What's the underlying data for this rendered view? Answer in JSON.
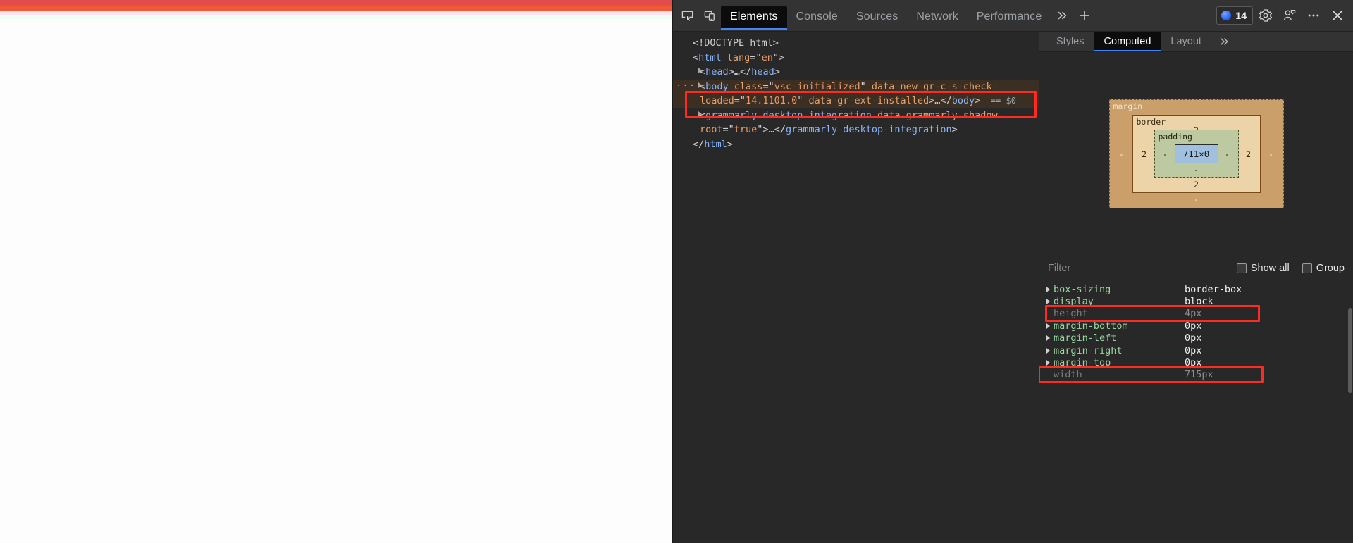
{
  "page": {
    "highlight_overlay": {
      "margin_color": "#e34c4c",
      "border_color": "#f05a32",
      "padding_color": "#fde4f1",
      "content_color": "#f0fdf4"
    }
  },
  "devtools": {
    "toolbar": {
      "inspect_icon": "inspect-element-icon",
      "device_icon": "device-toolbar-icon",
      "tabs": [
        {
          "label": "Elements",
          "active": true
        },
        {
          "label": "Console",
          "active": false
        },
        {
          "label": "Sources",
          "active": false
        },
        {
          "label": "Network",
          "active": false
        },
        {
          "label": "Performance",
          "active": false
        }
      ],
      "more_tabs_icon": "chevron-double-right-icon",
      "add_tab_icon": "plus-icon",
      "issues": {
        "count": "14",
        "dot_color": "#2f6bff"
      },
      "settings_icon": "gear-icon",
      "feedback_icon": "feedback-icon",
      "more_options_icon": "kebab-menu-icon",
      "close_icon": "close-icon"
    },
    "dom_tree": {
      "rows": [
        {
          "indent": 0,
          "twisty": false,
          "parts": [
            {
              "t": "punct",
              "v": "<!DOCTYPE html>"
            }
          ]
        },
        {
          "indent": 0,
          "twisty": false,
          "parts": [
            {
              "t": "punct",
              "v": "<"
            },
            {
              "t": "tag",
              "v": "html"
            },
            {
              "t": "punct",
              "v": " "
            },
            {
              "t": "attr",
              "v": "lang"
            },
            {
              "t": "punct",
              "v": "=\""
            },
            {
              "t": "attrval",
              "v": "en"
            },
            {
              "t": "punct",
              "v": "\">"
            }
          ]
        },
        {
          "indent": 1,
          "twisty": true,
          "parts": [
            {
              "t": "punct",
              "v": "<"
            },
            {
              "t": "tag",
              "v": "head"
            },
            {
              "t": "punct",
              "v": ">"
            },
            {
              "t": "text-node",
              "v": "…"
            },
            {
              "t": "punct",
              "v": "</"
            },
            {
              "t": "tag",
              "v": "head"
            },
            {
              "t": "punct",
              "v": ">"
            }
          ]
        },
        {
          "indent": 1,
          "twisty": true,
          "selected": true,
          "parts": [
            {
              "t": "punct",
              "v": "<"
            },
            {
              "t": "tag",
              "v": "body"
            },
            {
              "t": "punct",
              "v": " "
            },
            {
              "t": "attr",
              "v": "class"
            },
            {
              "t": "punct",
              "v": "=\""
            },
            {
              "t": "attrval",
              "v": "vsc-initialized"
            },
            {
              "t": "punct",
              "v": "\" "
            },
            {
              "t": "attr",
              "v": "data-new-gr-c-s-check-loaded"
            },
            {
              "t": "punct",
              "v": "=\""
            },
            {
              "t": "attrval",
              "v": "14.1101.0"
            },
            {
              "t": "punct",
              "v": "\" "
            },
            {
              "t": "attr",
              "v": "data-gr-ext-installed"
            },
            {
              "t": "punct",
              "v": ">"
            },
            {
              "t": "text-node",
              "v": "…"
            },
            {
              "t": "punct",
              "v": "</"
            },
            {
              "t": "tag",
              "v": "body"
            },
            {
              "t": "punct",
              "v": ">"
            }
          ]
        },
        {
          "indent": 1,
          "twisty": true,
          "parts": [
            {
              "t": "punct",
              "v": "<"
            },
            {
              "t": "tag",
              "v": "grammarly-desktop-integration"
            },
            {
              "t": "punct",
              "v": " "
            },
            {
              "t": "attr",
              "v": "data-grammarly-shadow-root"
            },
            {
              "t": "punct",
              "v": "=\""
            },
            {
              "t": "attrval",
              "v": "true"
            },
            {
              "t": "punct",
              "v": "\">"
            },
            {
              "t": "text-node",
              "v": "…"
            },
            {
              "t": "punct",
              "v": "</"
            },
            {
              "t": "tag",
              "v": "grammarly-desktop-integration"
            },
            {
              "t": "punct",
              "v": ">"
            }
          ]
        },
        {
          "indent": 0,
          "twisty": false,
          "parts": [
            {
              "t": "punct",
              "v": "</"
            },
            {
              "t": "tag",
              "v": "html"
            },
            {
              "t": "punct",
              "v": ">"
            }
          ]
        }
      ],
      "selected_marker": "== $0",
      "overflow_ellipsis": "···"
    },
    "styles_sidebar": {
      "tabs": [
        {
          "label": "Styles",
          "active": false
        },
        {
          "label": "Computed",
          "active": true
        },
        {
          "label": "Layout",
          "active": false
        }
      ],
      "overflow_icon": "chevron-double-right-icon",
      "box_model": {
        "margin_label": "margin",
        "margin": {
          "top": "-",
          "right": "-",
          "bottom": "-",
          "left": "-"
        },
        "border_label": "border",
        "border": {
          "top": "2",
          "right": "2",
          "bottom": "2",
          "left": "2"
        },
        "padding_label": "padding",
        "padding": {
          "top": "-",
          "right": "-",
          "bottom": "-",
          "left": "-"
        },
        "content": "711×0"
      },
      "filter": {
        "placeholder": "Filter",
        "value": "",
        "show_all_label": "Show all",
        "show_all_checked": false,
        "group_label": "Group",
        "group_checked": false
      },
      "computed_properties": [
        {
          "name": "box-sizing",
          "value": "border-box",
          "expandable": true,
          "dim": false
        },
        {
          "name": "display",
          "value": "block",
          "expandable": true,
          "dim": false
        },
        {
          "name": "height",
          "value": "4px",
          "expandable": false,
          "dim": true
        },
        {
          "name": "margin-bottom",
          "value": "0px",
          "expandable": true,
          "dim": false
        },
        {
          "name": "margin-left",
          "value": "0px",
          "expandable": true,
          "dim": false
        },
        {
          "name": "margin-right",
          "value": "0px",
          "expandable": true,
          "dim": false
        },
        {
          "name": "margin-top",
          "value": "0px",
          "expandable": true,
          "dim": false
        },
        {
          "name": "width",
          "value": "715px",
          "expandable": false,
          "dim": true
        }
      ]
    },
    "annotations": {
      "color": "#ff2a21",
      "count": 3,
      "targets": [
        "body-node-row",
        "height-property-row",
        "width-property-row"
      ]
    }
  }
}
